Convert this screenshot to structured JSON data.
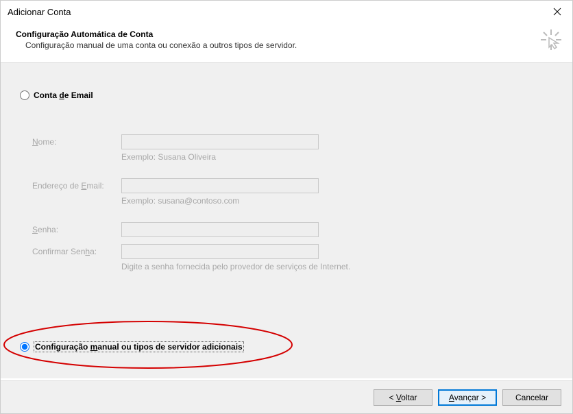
{
  "window": {
    "title": "Adicionar Conta"
  },
  "header": {
    "heading": "Configuração Automática de Conta",
    "subheading": "Configuração manual de uma conta ou conexão a outros tipos de servidor."
  },
  "options": {
    "email_account": {
      "label_prefix": "Conta ",
      "underline": "d",
      "label_suffix": "e Email",
      "selected": false
    },
    "manual_config": {
      "label_prefix": "Configuração ",
      "underline": "m",
      "label_suffix": "anual ou tipos de servidor adicionais",
      "selected": true
    }
  },
  "form": {
    "name": {
      "label_underline": "N",
      "label_rest": "ome:",
      "hint": "Exemplo: Susana Oliveira"
    },
    "email": {
      "label_prefix": "Endereço de ",
      "label_underline": "E",
      "label_suffix": "mail:",
      "hint": "Exemplo: susana@contoso.com"
    },
    "password": {
      "label_underline": "S",
      "label_rest": "enha:"
    },
    "confirm": {
      "label_prefix": "Confirmar Sen",
      "label_underline": "h",
      "label_suffix": "a:"
    },
    "password_hint": "Digite a senha fornecida pelo provedor de serviços de Internet."
  },
  "buttons": {
    "back": {
      "prefix": "< ",
      "underline": "V",
      "suffix": "oltar"
    },
    "next": {
      "underline": "A",
      "suffix": "vançar >"
    },
    "cancel": "Cancelar"
  }
}
